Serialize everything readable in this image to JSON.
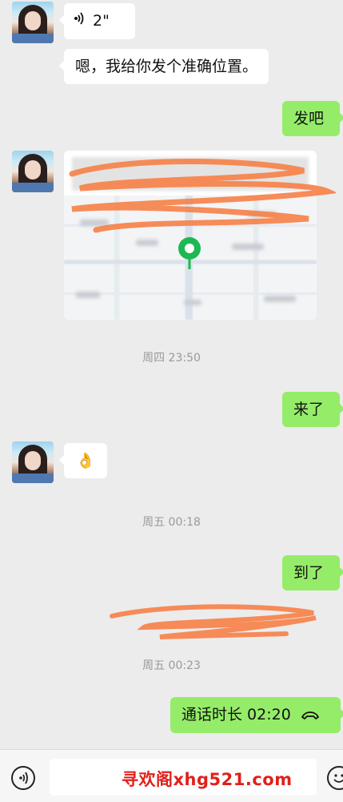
{
  "messages": {
    "voice_duration": "2\"",
    "location_intro": "嗯，我给你发个准确位置。",
    "send_it": "发吧",
    "coming": "来了",
    "ok_emoji": "👌",
    "arrived": "到了",
    "call_duration": "通话时长 02:20"
  },
  "timestamps": {
    "t1": "周四 23:50",
    "t2": "周五 00:18",
    "t3": "周五 00:23"
  },
  "icons": {
    "voice": "voice-wave-icon",
    "call": "phone-hangup-icon",
    "map_pin": "location-pin-icon",
    "input_voice": "voice-input-icon",
    "emoji": "emoji-icon"
  },
  "colors": {
    "background": "#ececec",
    "bubble_left": "#ffffff",
    "bubble_right": "#95ec69",
    "pin": "#1db853",
    "scribble": "#f6824a",
    "watermark": "#e0201a"
  },
  "watermark": "寻欢阁xhg521.com"
}
